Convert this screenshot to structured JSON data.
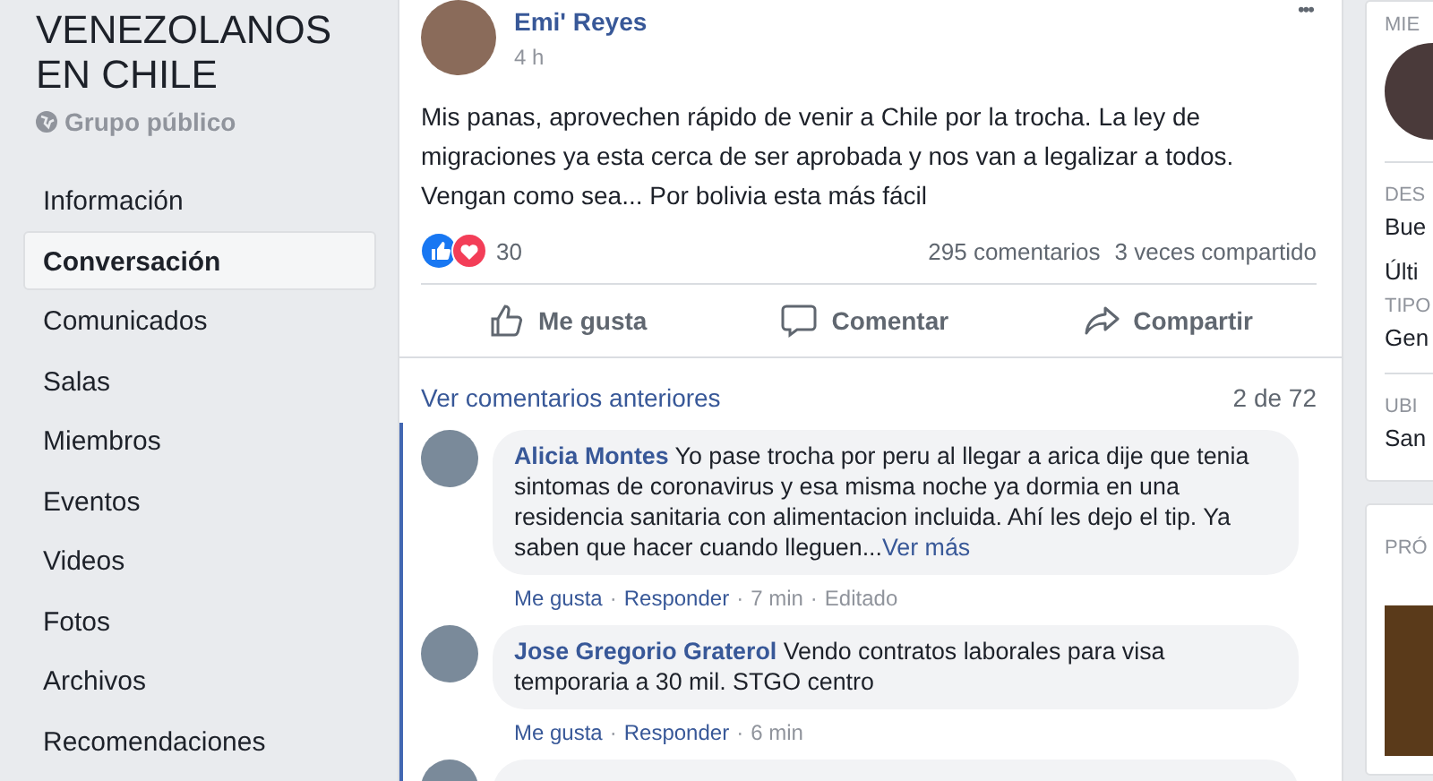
{
  "group": {
    "title": "VENEZOLANOS EN CHILE",
    "privacy": "Grupo público"
  },
  "nav": [
    {
      "label": "Información",
      "selected": false
    },
    {
      "label": "Conversación",
      "selected": true
    },
    {
      "label": "Comunicados",
      "selected": false
    },
    {
      "label": "Salas",
      "selected": false
    },
    {
      "label": "Miembros",
      "selected": false
    },
    {
      "label": "Eventos",
      "selected": false
    },
    {
      "label": "Videos",
      "selected": false
    },
    {
      "label": "Fotos",
      "selected": false
    },
    {
      "label": "Archivos",
      "selected": false
    },
    {
      "label": "Recomendaciones",
      "selected": false
    }
  ],
  "post": {
    "author": "Emi' Reyes",
    "time": "4 h",
    "more": "•••",
    "text": "Mis panas, aprovechen rápido de venir a Chile por la trocha. La ley de migraciones ya esta cerca de ser aprobada y nos van a legalizar a todos. Vengan como sea... Por bolivia esta más fácil",
    "reactions": "30",
    "comments": "295 comentarios",
    "shares": "3 veces compartido",
    "actions": [
      {
        "kind": "like",
        "label": "Me gusta"
      },
      {
        "kind": "comment",
        "label": "Comentar"
      },
      {
        "kind": "share",
        "label": "Compartir"
      }
    ]
  },
  "comments_header": {
    "link": "Ver comentarios anteriores",
    "count": "2 de 72"
  },
  "comments": [
    {
      "author": "Alicia Montes",
      "text": "Yo pase trocha por peru al llegar a arica dije que tenia sintomas de coronavirus y esa misma noche ya dormia en una residencia sanitaria con alimentacion incluida. Ahí les dejo el tip. Ya saben que hacer cuando lleguen...",
      "more": "Ver más",
      "like": "Me gusta",
      "reply": "Responder",
      "time": "7 min",
      "edited": "Editado",
      "separators": [
        "·",
        "·",
        "·"
      ]
    },
    {
      "author": "Jose Gregorio Graterol",
      "text": "Vendo contratos laborales para visa temporaria a 30 mil. STGO centro",
      "like": "Me gusta",
      "reply": "Responder",
      "time": "6 min",
      "separators": [
        "·",
        "·"
      ]
    }
  ],
  "right_panel": {
    "members_heading": "MIE",
    "description_heading": "DES",
    "description": "Bue",
    "last": "Últi",
    "type_heading": "TIPO",
    "type": "Gen",
    "location_heading": "UBI",
    "location": "San",
    "upcoming_heading": "PRÓ"
  }
}
